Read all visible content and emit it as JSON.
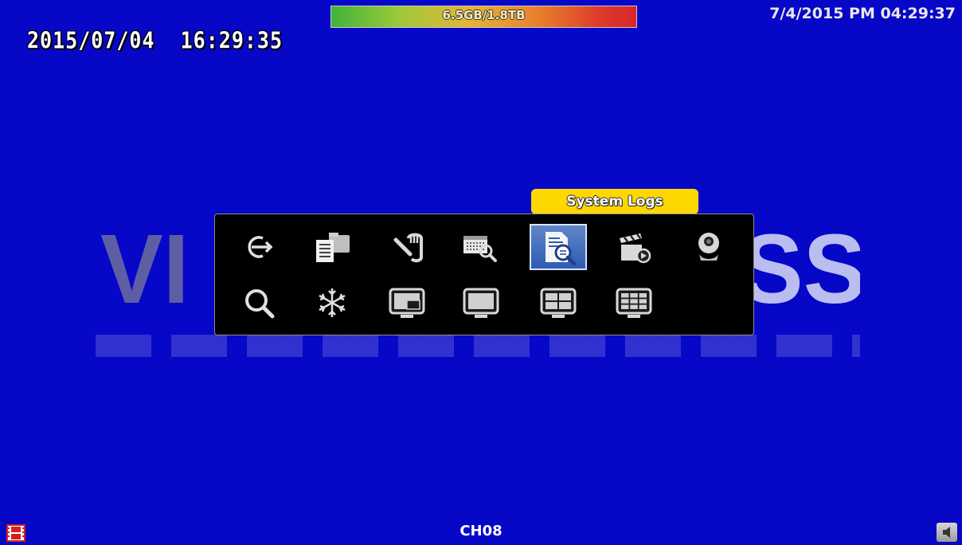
{
  "storage": {
    "text": "6.5GB/1.8TB"
  },
  "clock": {
    "top_right": "7/4/2015 PM 04:29:37",
    "osd_timestamp": "2015/07/04  16:29:35"
  },
  "watermark": {
    "left_text": "VI",
    "right_text": "SS"
  },
  "tooltip": {
    "label": "System Logs"
  },
  "menu": {
    "row1": [
      {
        "icon": "exit-icon"
      },
      {
        "icon": "folder-icon"
      },
      {
        "icon": "hand-icon"
      },
      {
        "icon": "calendar-search-icon"
      },
      {
        "icon": "system-logs-icon",
        "selected": true
      },
      {
        "icon": "clapperboard-icon"
      },
      {
        "icon": "camera-icon"
      }
    ],
    "row2": [
      {
        "icon": "zoom-icon"
      },
      {
        "icon": "freeze-icon"
      },
      {
        "icon": "pip-layout-icon"
      },
      {
        "icon": "single-view-icon"
      },
      {
        "icon": "quad-view-icon"
      },
      {
        "icon": "nine-view-icon"
      }
    ]
  },
  "channel": {
    "label": "CH08"
  },
  "colors": {
    "background": "#0707c8",
    "tooltip": "#ffd700",
    "selected_tile": "#2d5bb3",
    "panel": "#000000"
  }
}
